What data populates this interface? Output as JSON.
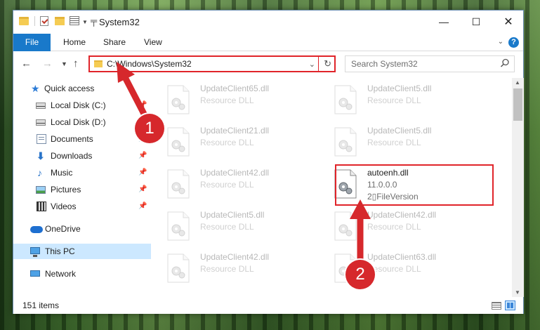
{
  "window": {
    "title": "System32",
    "minimize": "—",
    "maximize": "☐",
    "close": "✕"
  },
  "ribbon": {
    "tabs": [
      "File",
      "Home",
      "Share",
      "View"
    ],
    "help": "?"
  },
  "address_bar": {
    "path": "C:\\Windows\\System32"
  },
  "search": {
    "placeholder": "Search System32"
  },
  "sidebar": {
    "items": [
      {
        "label": "Quick access",
        "icon": "star-icon",
        "pinned": false
      },
      {
        "label": "Local Disk (C:)",
        "icon": "disk-icon",
        "pinned": true
      },
      {
        "label": "Local Disk (D:)",
        "icon": "disk-icon",
        "pinned": true
      },
      {
        "label": "Documents",
        "icon": "documents-icon",
        "pinned": true
      },
      {
        "label": "Downloads",
        "icon": "download-icon",
        "pinned": true
      },
      {
        "label": "Music",
        "icon": "music-icon",
        "pinned": true
      },
      {
        "label": "Pictures",
        "icon": "pictures-icon",
        "pinned": true
      },
      {
        "label": "Videos",
        "icon": "videos-icon",
        "pinned": true
      },
      {
        "label": "OneDrive",
        "icon": "onedrive-icon",
        "pinned": false
      },
      {
        "label": "This PC",
        "icon": "this-pc-icon",
        "pinned": false,
        "selected": true
      },
      {
        "label": "Network",
        "icon": "network-icon",
        "pinned": false
      }
    ]
  },
  "files": [
    {
      "name": "UpdateClient65.dll",
      "line1": "Resource DLL",
      "line2": "",
      "faded": true
    },
    {
      "name": "UpdateClient5.dll",
      "line1": "Resource DLL",
      "line2": "",
      "faded": true
    },
    {
      "name": "UpdateClient21.dll",
      "line1": "Resource DLL",
      "line2": "",
      "faded": true
    },
    {
      "name": "UpdateClient5.dll",
      "line1": "Resource DLL",
      "line2": "",
      "faded": true
    },
    {
      "name": "UpdateClient42.dll",
      "line1": "Resource DLL",
      "line2": "",
      "faded": true
    },
    {
      "name": "autoenh.dll",
      "line1": "11.0.0.0",
      "line2": "2▯FileVersion",
      "faded": false
    },
    {
      "name": "UpdateClient5.dll",
      "line1": "Resource DLL",
      "line2": "",
      "faded": true
    },
    {
      "name": "UpdateClient42.dll",
      "line1": "Resource DLL",
      "line2": "",
      "faded": true
    },
    {
      "name": "UpdateClient42.dll",
      "line1": "Resource DLL",
      "line2": "",
      "faded": true
    },
    {
      "name": "UpdateClient63.dll",
      "line1": "Resource DLL",
      "line2": "",
      "faded": true
    }
  ],
  "status": {
    "item_count": "151 items"
  },
  "annotations": {
    "callout_1": "1",
    "callout_2": "2",
    "color": "#e0242a"
  },
  "colors": {
    "accent": "#1979ca",
    "highlight": "#e0242a",
    "selected_bg": "#cce8ff"
  }
}
